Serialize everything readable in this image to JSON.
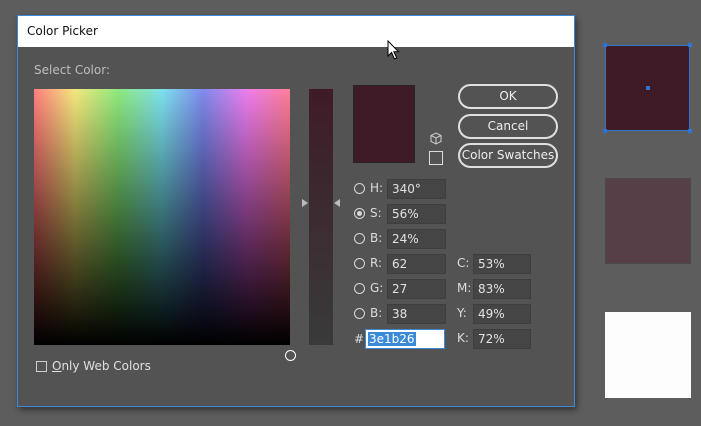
{
  "dialog": {
    "title": "Color Picker",
    "select_label": "Select Color:"
  },
  "colors": {
    "current": "#3e1b26",
    "swatch_middle": "#563f46",
    "swatch_bottom": "#fdfdfd",
    "accent": "#3b8ad8"
  },
  "buttons": {
    "ok": "OK",
    "cancel": "Cancel",
    "swatches": "Color Swatches"
  },
  "hsb": {
    "h": {
      "label": "H:",
      "value": "340°",
      "selected": false
    },
    "s": {
      "label": "S:",
      "value": "56%",
      "selected": true
    },
    "b": {
      "label": "B:",
      "value": "24%",
      "selected": false
    }
  },
  "rgb": {
    "r": {
      "label": "R:",
      "value": "62",
      "selected": false
    },
    "g": {
      "label": "G:",
      "value": "27",
      "selected": false
    },
    "b": {
      "label": "B:",
      "value": "38",
      "selected": false
    }
  },
  "cmyk": {
    "c": {
      "label": "C:",
      "value": "53%"
    },
    "m": {
      "label": "M:",
      "value": "83%"
    },
    "y": {
      "label": "Y:",
      "value": "49%"
    },
    "k": {
      "label": "K:",
      "value": "72%"
    }
  },
  "hex": {
    "label": "#",
    "value": "3e1b26"
  },
  "web_colors": {
    "label_underlined": "O",
    "label_rest": "nly Web Colors",
    "checked": false
  },
  "icons": {
    "cube": "web-safe-cube-icon",
    "warning_swatch": "out-of-gamut-swatch-icon",
    "cursor": "mouse-pointer-icon"
  }
}
